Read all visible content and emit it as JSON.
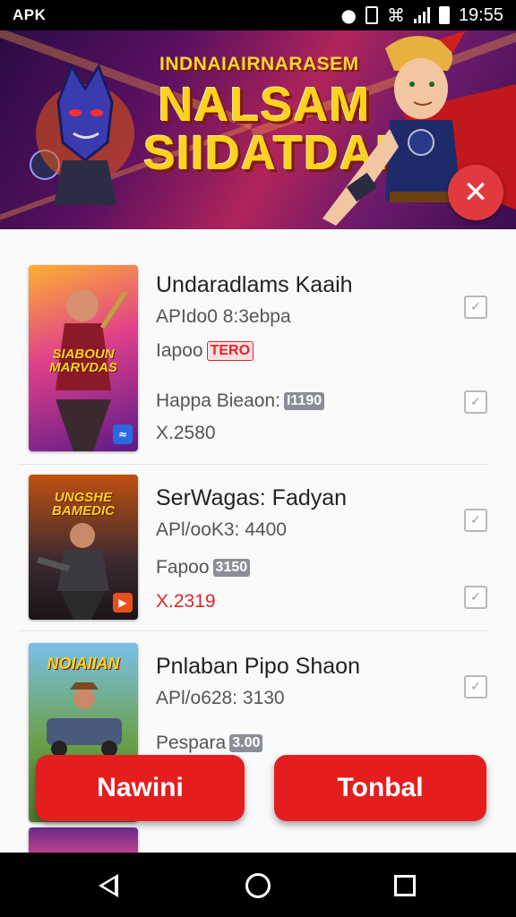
{
  "status_bar": {
    "carrier": "APK",
    "time": "19:55",
    "icons": [
      "alarm-icon",
      "dnd-icon",
      "wifi-icon",
      "signal-icon",
      "battery-icon"
    ]
  },
  "banner": {
    "subtitle": "INDNAIAIRNARASEM",
    "title_line1": "NALSAM",
    "title_line2": "SIIDATDAN",
    "close_icon": "close-icon"
  },
  "items": [
    {
      "thumb_title": "SIABOUN MARVDAS",
      "title": "Undaradlams Kaaih",
      "line1": "APIdo0 8:3ebpa",
      "line2_label": "Iapoo",
      "line2_tag": "TERO",
      "line3_label": "Happa Bieaon:",
      "line3_tag": "I1190",
      "price": "X.2580",
      "badge_icon": "messenger-icon"
    },
    {
      "thumb_title": "UNGSHE BAMEDIC",
      "title": "SerWagas: Fadyan",
      "line1": "APl/ooK3: 4400",
      "line2_label": "Fapoo",
      "line2_tag": "3150",
      "price": "X.2319",
      "badge_icon": "play-icon"
    },
    {
      "thumb_title": "NOIAIIAN",
      "title": "Pnlaban Pipo Shaon",
      "line1": "APl/o628: 3130",
      "line2_label": "Pespara",
      "line2_tag": "3.00"
    }
  ],
  "buttons": {
    "left_label": "Nawini",
    "right_label": "Tonbal"
  },
  "colors": {
    "accent_red": "#e41e1e",
    "banner_yellow": "#ffd21f",
    "price_red": "#e0242a"
  }
}
